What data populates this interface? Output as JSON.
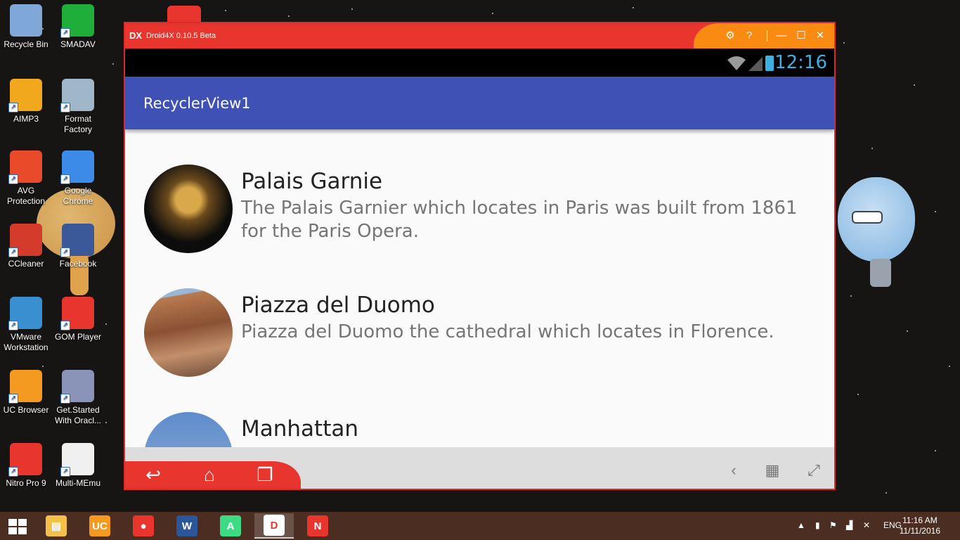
{
  "desktop": {
    "icons": [
      {
        "label": "Recycle Bin",
        "icon": "recycle-bin-icon",
        "color": "#7fa8d8"
      },
      {
        "label": "SMADAV",
        "icon": "smadav-icon",
        "color": "#1fae3a"
      },
      {
        "label": "AIMP3",
        "icon": "aimp-icon",
        "color": "#f2a81c"
      },
      {
        "label": "Format Factory",
        "icon": "format-factory-icon",
        "color": "#9fb7c9"
      },
      {
        "label": "AVG Protection",
        "icon": "avg-icon",
        "color": "#e84a2a"
      },
      {
        "label": "Google Chrome",
        "icon": "chrome-icon",
        "color": "#3d8be8"
      },
      {
        "label": "CCleaner",
        "icon": "ccleaner-icon",
        "color": "#d43b2b"
      },
      {
        "label": "Facebook",
        "icon": "facebook-icon",
        "color": "#3b5998"
      },
      {
        "label": "VMware Workstation",
        "icon": "vmware-icon",
        "color": "#3a8fd0"
      },
      {
        "label": "GOM Player",
        "icon": "gom-player-icon",
        "color": "#e8352e"
      },
      {
        "label": "UC Browser",
        "icon": "uc-browser-icon",
        "color": "#f49a21"
      },
      {
        "label": "Get.Started With Oracl...",
        "icon": "oracle-db-icon",
        "color": "#8a93b8"
      },
      {
        "label": "Nitro Pro 9",
        "icon": "nitro-icon",
        "color": "#e8352e"
      },
      {
        "label": "Multi-MEmu",
        "icon": "memu-icon",
        "color": "#f0f0f0"
      }
    ]
  },
  "emulator": {
    "title": "Droid4X 0.10.5 Beta",
    "status_time": "12:16",
    "app_title": "RecyclerView1",
    "items": [
      {
        "title": "Palais Garnie",
        "description": "The Palais Garnier which locates in Paris was built from 1861 for the Paris Opera."
      },
      {
        "title": "Piazza del Duomo",
        "description": "Piazza del Duomo the cathedral which locates in Florence."
      },
      {
        "title": "Manhattan",
        "description": ""
      }
    ]
  },
  "taskbar": {
    "language": "ENG",
    "time": "11:16 AM",
    "date": "11/11/2016",
    "apps": [
      {
        "name": "file-explorer",
        "color": "#f4c04a",
        "glyph": "▤"
      },
      {
        "name": "uc-browser",
        "color": "#f49a21",
        "glyph": "UC"
      },
      {
        "name": "gom-player",
        "color": "#e8352e",
        "glyph": "●"
      },
      {
        "name": "word",
        "color": "#2b579a",
        "glyph": "W"
      },
      {
        "name": "android-studio",
        "color": "#3ddc84",
        "glyph": "A"
      },
      {
        "name": "droid4x",
        "color": "#ffffff",
        "glyph": "D"
      },
      {
        "name": "nitro-pro",
        "color": "#e8352e",
        "glyph": "N"
      }
    ]
  },
  "colors": {
    "accent": "#3f51b5",
    "emulator_red": "#e8352e",
    "emulator_orange": "#f98a12"
  }
}
